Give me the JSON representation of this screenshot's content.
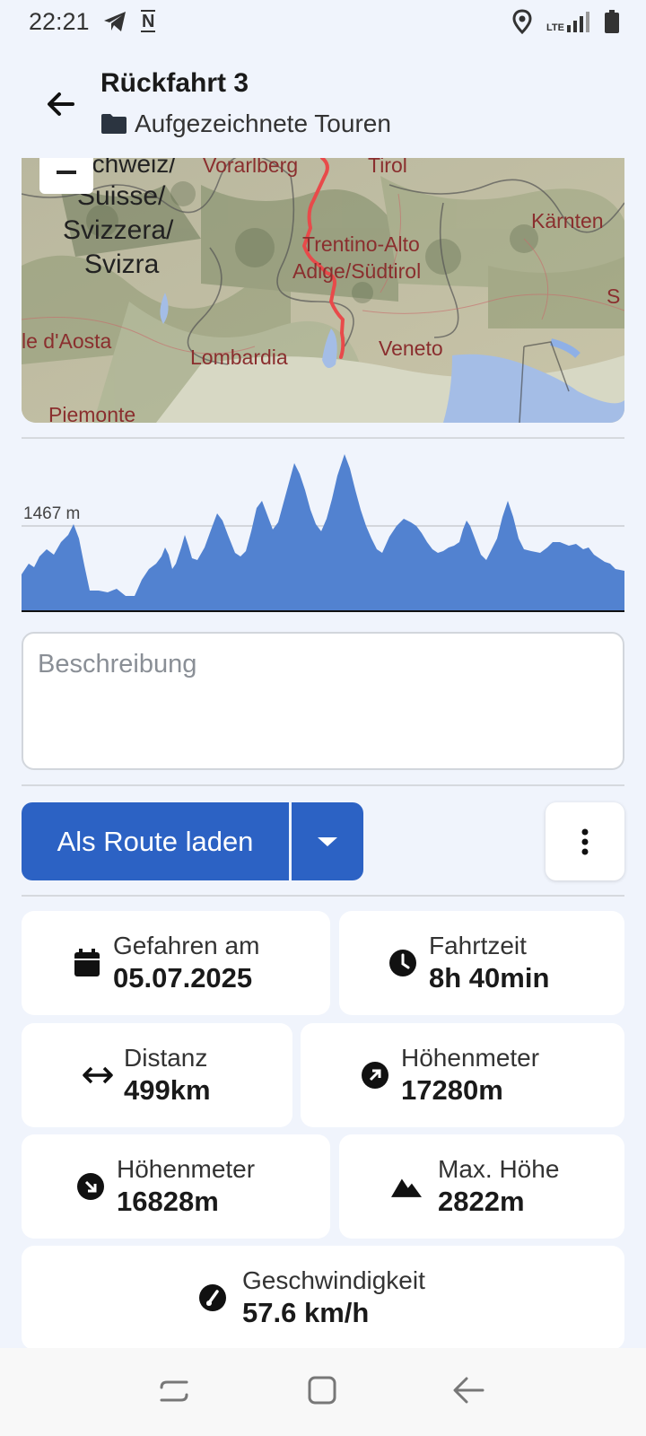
{
  "status": {
    "time": "22:21",
    "network": "LTE"
  },
  "header": {
    "title": "Rückfahrt 3",
    "folder": "Aufgezeichnete Touren"
  },
  "map": {
    "labels": [
      "Schweiz/",
      "Suisse/",
      "Svizzera/",
      "Svizra",
      "Vorarlberg",
      "Tirol",
      "Kärnten",
      "Trentino-Alto",
      "Adige/Südtirol",
      "le d'Aosta",
      "Lombardia",
      "Veneto",
      "Piemonte",
      "S"
    ]
  },
  "elevation": {
    "ref_label": "1467 m"
  },
  "description": {
    "placeholder": "Beschreibung"
  },
  "actions": {
    "route_label": "Als Route laden"
  },
  "stats": {
    "date": {
      "label": "Gefahren am",
      "value": "05.07.2025"
    },
    "time": {
      "label": "Fahrtzeit",
      "value": "8h 40min"
    },
    "distance": {
      "label": "Distanz",
      "value": "499km"
    },
    "ascent": {
      "label": "Höhenmeter",
      "value": "17280m"
    },
    "descent": {
      "label": "Höhenmeter",
      "value": "16828m"
    },
    "max": {
      "label": "Max. Höhe",
      "value": "2822m"
    },
    "speed": {
      "label": "Geschwindigkeit",
      "value": "57.6 km/h"
    }
  },
  "colors": {
    "primary": "#2c62c4",
    "elevation": "#5282d0",
    "track": "#e84a4a"
  }
}
